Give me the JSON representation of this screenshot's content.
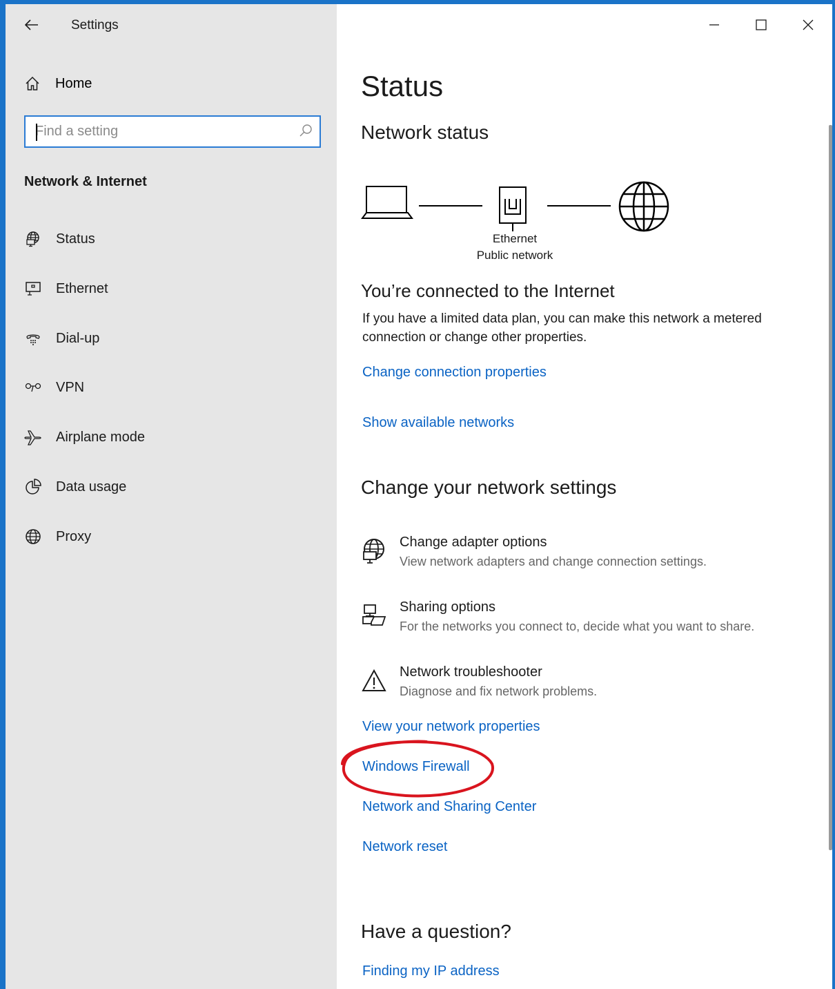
{
  "window": {
    "app_title": "Settings"
  },
  "sidebar": {
    "home_label": "Home",
    "search_placeholder": "Find a setting",
    "section_title": "Network & Internet",
    "items": [
      {
        "label": "Status",
        "icon": "globe-monitor-icon",
        "selected": true
      },
      {
        "label": "Ethernet",
        "icon": "ethernet-icon",
        "selected": false
      },
      {
        "label": "Dial-up",
        "icon": "dial-up-phone-icon",
        "selected": false
      },
      {
        "label": "VPN",
        "icon": "vpn-icon",
        "selected": false
      },
      {
        "label": "Airplane mode",
        "icon": "airplane-icon",
        "selected": false
      },
      {
        "label": "Data usage",
        "icon": "pie-chart-icon",
        "selected": false
      },
      {
        "label": "Proxy",
        "icon": "globe-icon",
        "selected": false
      }
    ]
  },
  "main": {
    "page_title": "Status",
    "network_status_heading": "Network status",
    "diagram": {
      "connection_name": "Ethernet",
      "network_type": "Public network"
    },
    "connected_heading": "You’re connected to the Internet",
    "connected_text": "If you have a limited data plan, you can make this network a metered connection or change other properties.",
    "links_top": [
      "Change connection properties",
      "Show available networks"
    ],
    "change_settings_heading": "Change your network settings",
    "settings": [
      {
        "title": "Change adapter options",
        "desc": "View network adapters and change connection settings.",
        "icon": "adapter-globe-icon"
      },
      {
        "title": "Sharing options",
        "desc": "For the networks you connect to, decide what you want to share.",
        "icon": "sharing-icon"
      },
      {
        "title": "Network troubleshooter",
        "desc": "Diagnose and fix network problems.",
        "icon": "warning-icon"
      }
    ],
    "links_bottom": [
      "View your network properties",
      "Windows Firewall",
      "Network and Sharing Center",
      "Network reset"
    ],
    "question_heading": "Have a question?",
    "question_links": [
      "Finding my IP address"
    ]
  },
  "colors": {
    "accent": "#0a63c4",
    "window_border": "#1a73c8",
    "sidebar_bg": "#e6e6e6",
    "annotation": "#d9141e"
  }
}
